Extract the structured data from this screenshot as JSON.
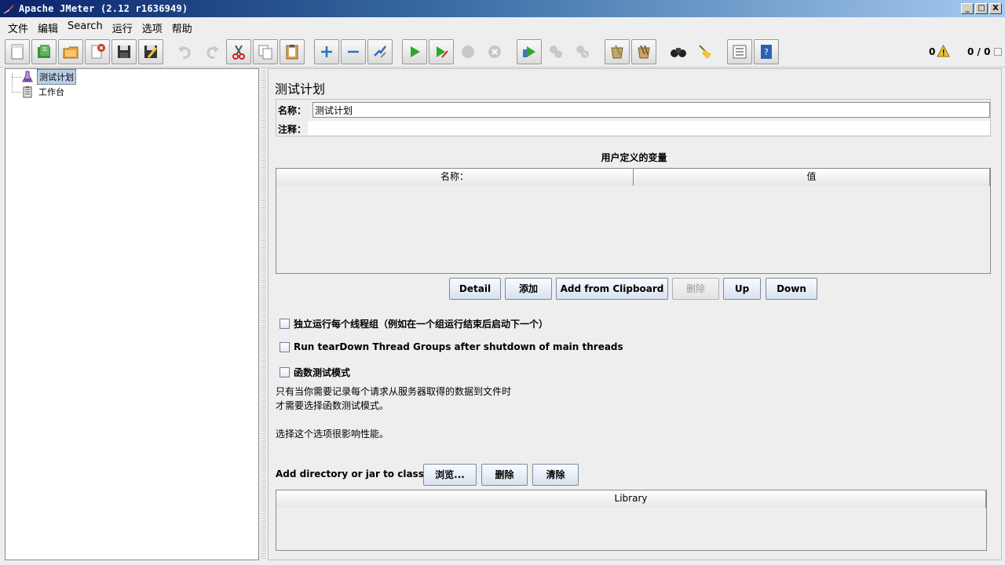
{
  "window": {
    "title": "Apache JMeter (2.12 r1636949)",
    "controls": {
      "minimize": "_",
      "maximize": "□",
      "close": "X"
    }
  },
  "menu": [
    "文件",
    "编辑",
    "Search",
    "运行",
    "选项",
    "帮助"
  ],
  "toolbar": {
    "buttons": [
      "new-icon",
      "templates-icon",
      "open-icon",
      "close-icon",
      "save-icon",
      "save-as-icon",
      "undo-icon",
      "redo-icon",
      "cut-icon",
      "copy-icon",
      "paste-icon",
      "expand-icon",
      "collapse-icon",
      "toggle-icon",
      "start-icon",
      "start-no-pause-icon",
      "stop-icon",
      "shutdown-icon",
      "remote-start-icon",
      "remote-stop-icon",
      "remote-shutdown-icon",
      "clear-icon",
      "clear-all-icon",
      "search-icon",
      "reset-search-icon",
      "function-helper-icon",
      "help-icon"
    ],
    "error_count": "0",
    "thread_count": "0 / 0"
  },
  "tree": {
    "items": [
      {
        "label": "测试计划",
        "icon": "test-plan-icon",
        "selected": true
      },
      {
        "label": "工作台",
        "icon": "workbench-icon",
        "selected": false
      }
    ]
  },
  "plan": {
    "title": "测试计划",
    "name_label": "名称：",
    "name_value": "测试计划",
    "comment_label": "注释：",
    "comment_value": "",
    "variables_title": "用户定义的变量",
    "variables_columns": [
      "名称：",
      "值"
    ],
    "variables_rows": [],
    "buttons": {
      "detail": "Detail",
      "add": "添加",
      "add_from_clipboard": "Add from Clipboard",
      "delete": "删除",
      "up": "Up",
      "down": "Down"
    },
    "checkboxes": [
      {
        "label": "独立运行每个线程组（例如在一个组运行结束后启动下一个）",
        "checked": false
      },
      {
        "label": "Run tearDown Thread Groups after shutdown of main threads",
        "checked": false
      },
      {
        "label": "函数测试模式",
        "checked": false
      }
    ],
    "help_lines": [
      "只有当你需要记录每个请求从服务器取得的数据到文件时",
      "才需要选择函数测试模式。",
      "",
      "选择这个选项很影响性能。"
    ],
    "classpath_label": "Add directory or jar to classpath",
    "classpath_buttons": {
      "browse": "浏览...",
      "delete": "删除",
      "clear": "清除"
    },
    "library_column": "Library",
    "library_rows": []
  }
}
